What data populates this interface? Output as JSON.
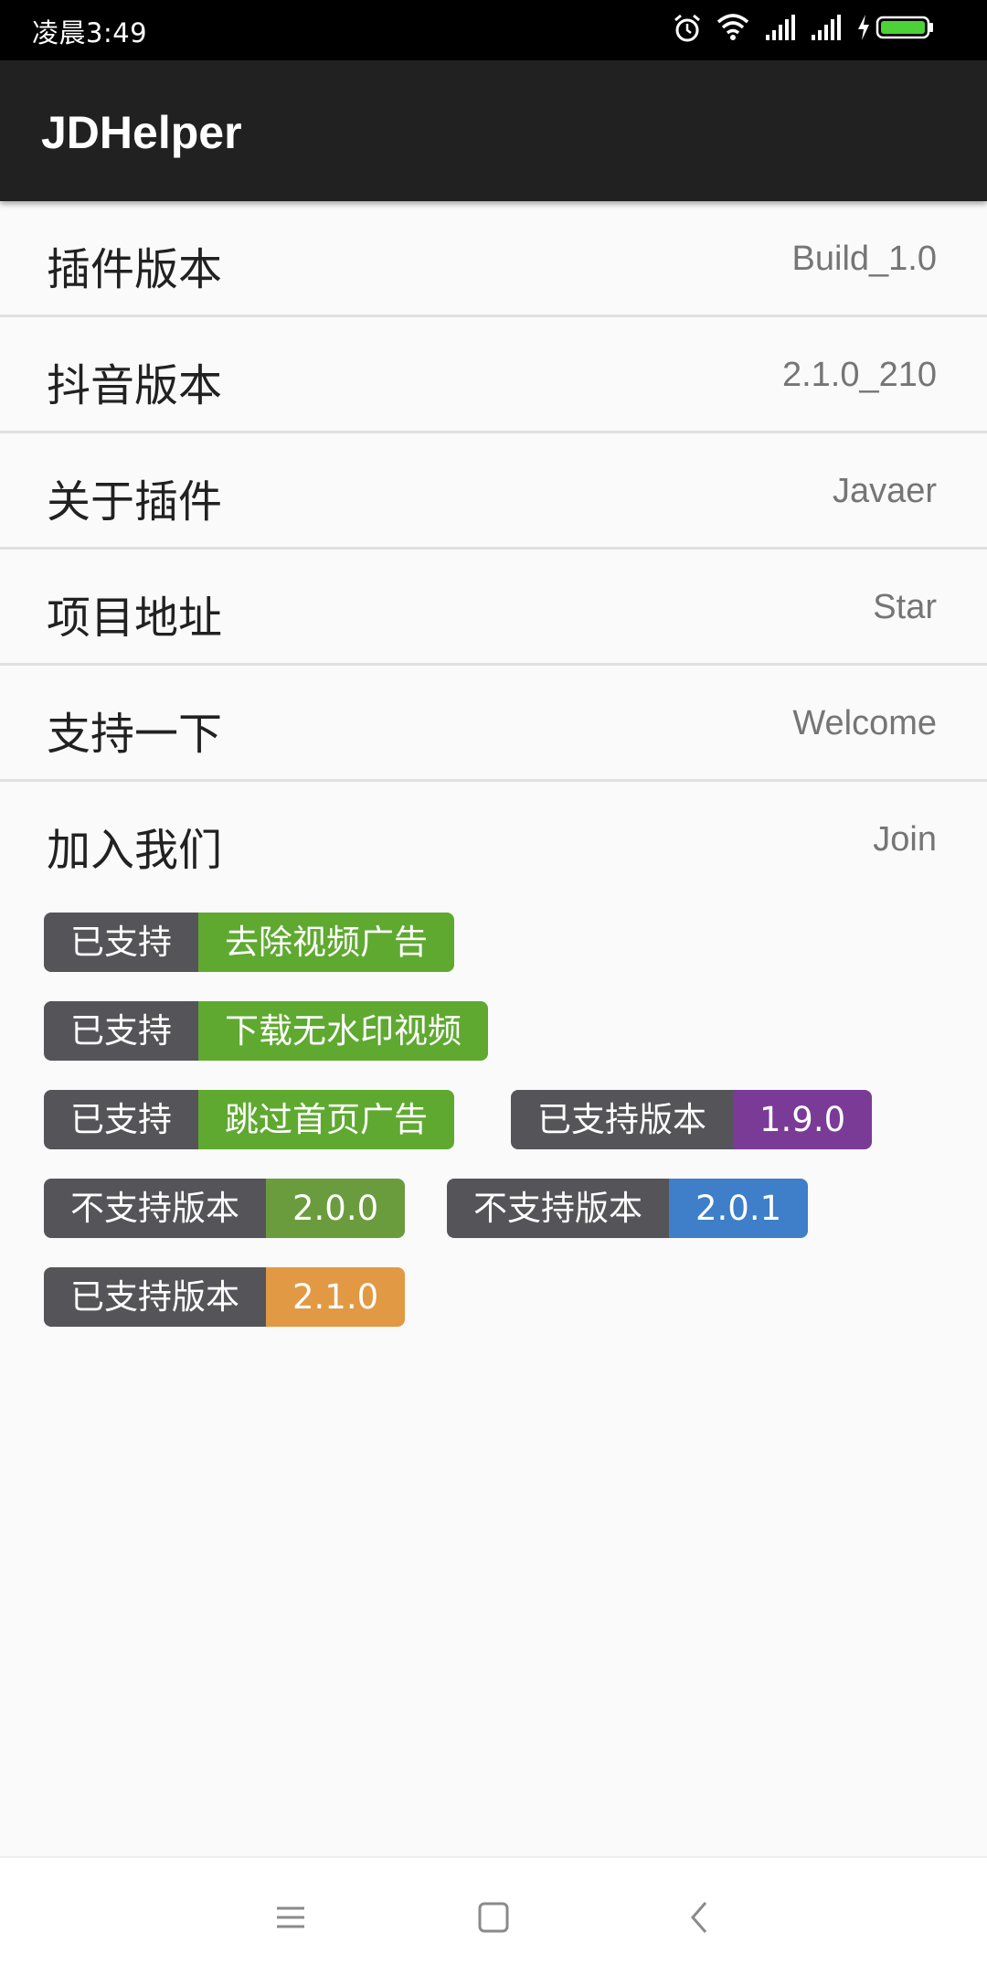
{
  "status_bar": {
    "time": "凌晨3:49",
    "icons": [
      "alarm-icon",
      "wifi-icon",
      "signal-icon",
      "signal-icon",
      "charging-icon",
      "battery-icon"
    ]
  },
  "app_bar": {
    "title": "JDHelper"
  },
  "settings": [
    {
      "label": "插件版本",
      "value": "Build_1.0"
    },
    {
      "label": "抖音版本",
      "value": "2.1.0_210"
    },
    {
      "label": "关于插件",
      "value": "Javaer"
    },
    {
      "label": "项目地址",
      "value": "Star"
    },
    {
      "label": "支持一下",
      "value": "Welcome"
    },
    {
      "label": "加入我们",
      "value": "Join"
    }
  ],
  "badges": [
    {
      "left": "已支持",
      "right": "去除视频广告",
      "color": "#5fa930"
    },
    {
      "left": "已支持",
      "right": "下载无水印视频",
      "color": "#5fa930"
    },
    {
      "left": "已支持",
      "right": "跳过首页广告",
      "color": "#5fa930"
    },
    {
      "left": "已支持版本",
      "right": "1.9.0",
      "color": "#7a3b96"
    },
    {
      "left": "不支持版本",
      "right": "2.0.0",
      "color": "#6a9c3e"
    },
    {
      "left": "不支持版本",
      "right": "2.0.1",
      "color": "#3f7ec8"
    },
    {
      "left": "已支持版本",
      "right": "2.1.0",
      "color": "#e29944"
    }
  ],
  "nav_bar": {
    "icons": [
      "menu-icon",
      "home-icon",
      "back-icon"
    ]
  }
}
